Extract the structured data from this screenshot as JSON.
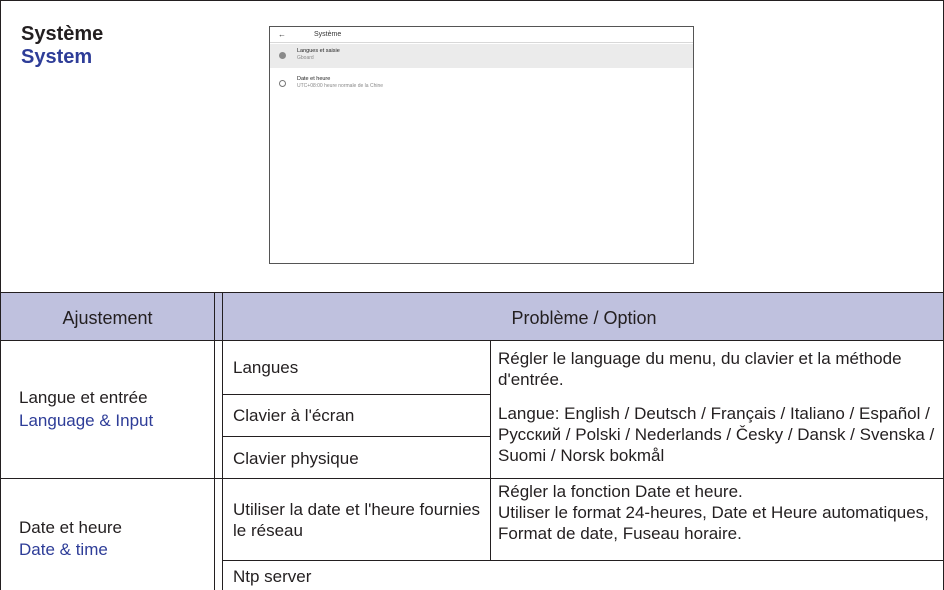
{
  "section": {
    "title_fr": "Système",
    "title_en": "System"
  },
  "screenshot": {
    "back_icon": "←",
    "title": "Système",
    "items": [
      {
        "title": "Langues et saisie",
        "subtitle": "Gboard"
      },
      {
        "title": "Date et heure",
        "subtitle": "UTC+08:00 heure normale de la Chine"
      }
    ]
  },
  "table": {
    "header": {
      "adjust": "Ajustement",
      "option": "Problème / Option"
    },
    "rows": [
      {
        "group_fr": "Langue et entrée",
        "group_en": "Language & Input",
        "items": [
          "Langues",
          "Clavier à l'écran",
          "Clavier physique"
        ],
        "desc1": "Régler le language du menu, du clavier et la méthode d'entrée.",
        "desc2": "Langue:  English / Deutsch / Français / Italiano / Español / Русский / Polski / Nederlands / Česky / Dansk / Svenska / Suomi / Norsk bokmål"
      },
      {
        "group_fr": "Date et heure",
        "group_en": "Date & time",
        "items": [
          "Utiliser la date et l'heure fournies le réseau",
          "Ntp server"
        ],
        "desc1": "Régler la fonction Date et heure.",
        "desc2": "Utiliser le format 24-heures, Date et Heure automatiques, Format de date, Fuseau horaire."
      }
    ]
  }
}
